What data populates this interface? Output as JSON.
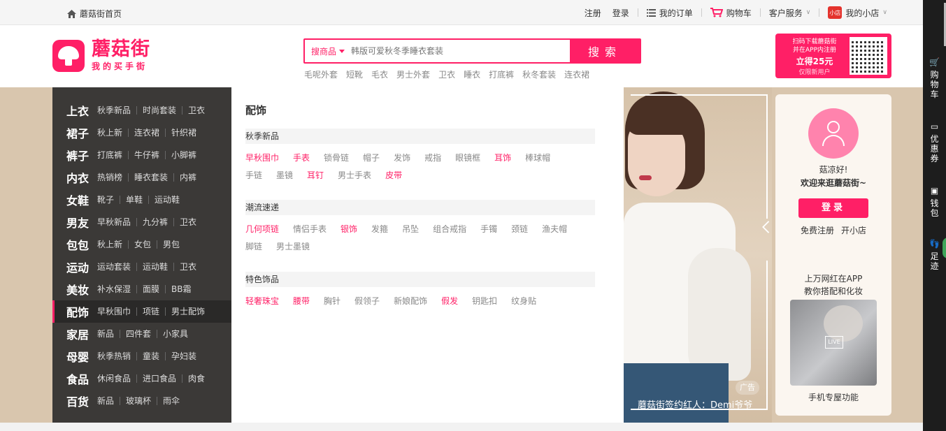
{
  "topbar": {
    "home": "蘑菇街首页",
    "register": "注册",
    "login": "登录",
    "orders": "我的订单",
    "cart": "购物车",
    "service": "客户服务",
    "shop_badge": "小店",
    "myshop": "我的小店"
  },
  "header": {
    "logo_big": "蘑菇街",
    "logo_small": "我的买手街",
    "search_type": "搜商品",
    "search_placeholder": "韩版可爱秋冬季睡衣套装",
    "search_button": "搜索",
    "hotwords": [
      "毛呢外套",
      "短靴",
      "毛衣",
      "男士外套",
      "卫衣",
      "睡衣",
      "打底裤",
      "秋冬套装",
      "连衣裙"
    ],
    "qr_line1": "扫码下载蘑菇街",
    "qr_line2": "并在APP内注册",
    "qr_price": "立得25元",
    "qr_new": "仅限新用户"
  },
  "categories": [
    {
      "name": "上衣",
      "subs": [
        "秋季新品",
        "时尚套装",
        "卫衣"
      ]
    },
    {
      "name": "裙子",
      "subs": [
        "秋上新",
        "连衣裙",
        "针织裙"
      ]
    },
    {
      "name": "裤子",
      "subs": [
        "打底裤",
        "牛仔裤",
        "小脚裤"
      ]
    },
    {
      "name": "内衣",
      "subs": [
        "热销榜",
        "睡衣套装",
        "内裤"
      ]
    },
    {
      "name": "女鞋",
      "subs": [
        "靴子",
        "单鞋",
        "运动鞋"
      ]
    },
    {
      "name": "男友",
      "subs": [
        "早秋新品",
        "九分裤",
        "卫衣"
      ]
    },
    {
      "name": "包包",
      "subs": [
        "秋上新",
        "女包",
        "男包"
      ]
    },
    {
      "name": "运动",
      "subs": [
        "运动套装",
        "运动鞋",
        "卫衣"
      ]
    },
    {
      "name": "美妆",
      "subs": [
        "补水保湿",
        "面膜",
        "BB霜"
      ]
    },
    {
      "name": "配饰",
      "subs": [
        "早秋围巾",
        "项链",
        "男士配饰"
      ]
    },
    {
      "name": "家居",
      "subs": [
        "新品",
        "四件套",
        "小家具"
      ]
    },
    {
      "name": "母婴",
      "subs": [
        "秋季热销",
        "童装",
        "孕妇装"
      ]
    },
    {
      "name": "食品",
      "subs": [
        "休闲食品",
        "进口食品",
        "肉食"
      ]
    },
    {
      "name": "百货",
      "subs": [
        "新品",
        "玻璃杯",
        "雨伞"
      ]
    }
  ],
  "flyout": {
    "title": "配饰",
    "groups": [
      {
        "header": "秋季新品",
        "items": [
          {
            "t": "早秋围巾",
            "hot": true
          },
          {
            "t": "手表",
            "hot": true
          },
          {
            "t": "锁骨链",
            "hot": false
          },
          {
            "t": "帽子",
            "hot": false
          },
          {
            "t": "发饰",
            "hot": false
          },
          {
            "t": "戒指",
            "hot": false
          },
          {
            "t": "眼镜框",
            "hot": false
          },
          {
            "t": "耳饰",
            "hot": true
          },
          {
            "t": "棒球帽",
            "hot": false
          },
          {
            "t": "手链",
            "hot": false
          },
          {
            "t": "墨镜",
            "hot": false
          },
          {
            "t": "耳钉",
            "hot": true
          },
          {
            "t": "男士手表",
            "hot": false
          },
          {
            "t": "皮带",
            "hot": true
          }
        ]
      },
      {
        "header": "潮流速递",
        "items": [
          {
            "t": "几何项链",
            "hot": true
          },
          {
            "t": "情侣手表",
            "hot": false
          },
          {
            "t": "银饰",
            "hot": true
          },
          {
            "t": "发箍",
            "hot": false
          },
          {
            "t": "吊坠",
            "hot": false
          },
          {
            "t": "组合戒指",
            "hot": false
          },
          {
            "t": "手镯",
            "hot": false
          },
          {
            "t": "颈链",
            "hot": false
          },
          {
            "t": "渔夫帽",
            "hot": false
          },
          {
            "t": "脚链",
            "hot": false
          },
          {
            "t": "男士墨镜",
            "hot": false
          }
        ]
      },
      {
        "header": "特色饰品",
        "items": [
          {
            "t": "轻奢珠宝",
            "hot": true
          },
          {
            "t": "腰带",
            "hot": true
          },
          {
            "t": "胸针",
            "hot": false
          },
          {
            "t": "假领子",
            "hot": false
          },
          {
            "t": "新娘配饰",
            "hot": false
          },
          {
            "t": "假发",
            "hot": true
          },
          {
            "t": "钥匙扣",
            "hot": false
          },
          {
            "t": "纹身贴",
            "hot": false
          }
        ]
      }
    ]
  },
  "banner": {
    "ad_tag": "广告",
    "caption": "蘑菇街签约红人：Demi爷爷"
  },
  "user": {
    "hi": "菇凉好!",
    "welcome": "欢迎来逛蘑菇街~",
    "login": "登录",
    "register": "免费注册",
    "openshop": "开小店",
    "promo1": "上万网红在APP",
    "promo2": "教你搭配和化妆",
    "live": "LIVE",
    "mobile": "手机专屋功能"
  },
  "sidebar": [
    {
      "label": "购物车",
      "icon": "cart-icon"
    },
    {
      "label": "优惠券",
      "icon": "coupon-icon"
    },
    {
      "label": "钱包",
      "icon": "wallet-icon"
    },
    {
      "label": "足迹",
      "icon": "footprint-icon"
    }
  ],
  "colors": {
    "brand": "#ff1f66",
    "nav_bg": "#3b3937",
    "hero_bg": "#d9c6ae"
  }
}
